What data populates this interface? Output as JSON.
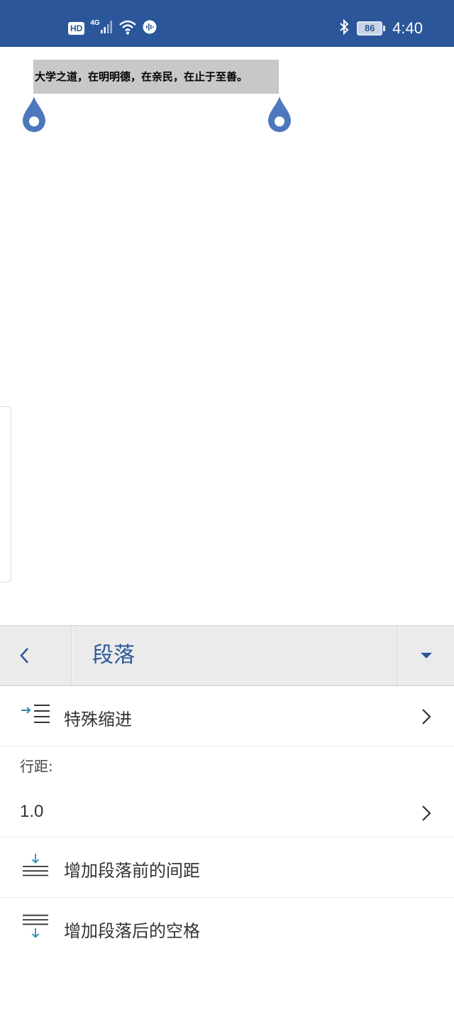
{
  "status_bar": {
    "hd": "HD",
    "network": "4G",
    "battery_level": "86",
    "time": "4:40"
  },
  "document": {
    "selected_text": "大学之道，在明明德，在亲民，在止于至善。"
  },
  "panel": {
    "title": "段落"
  },
  "menu": {
    "special_indent": "特殊缩进",
    "line_spacing_label": "行距:",
    "line_spacing_value": "1.0",
    "space_before": "增加段落前的间距",
    "space_after": "增加段落后的空格"
  },
  "colors": {
    "accent": "#2b579a",
    "icon_teal": "#2a8db3",
    "selection": "#c8c8c8",
    "panel_bg": "#ebebeb"
  }
}
